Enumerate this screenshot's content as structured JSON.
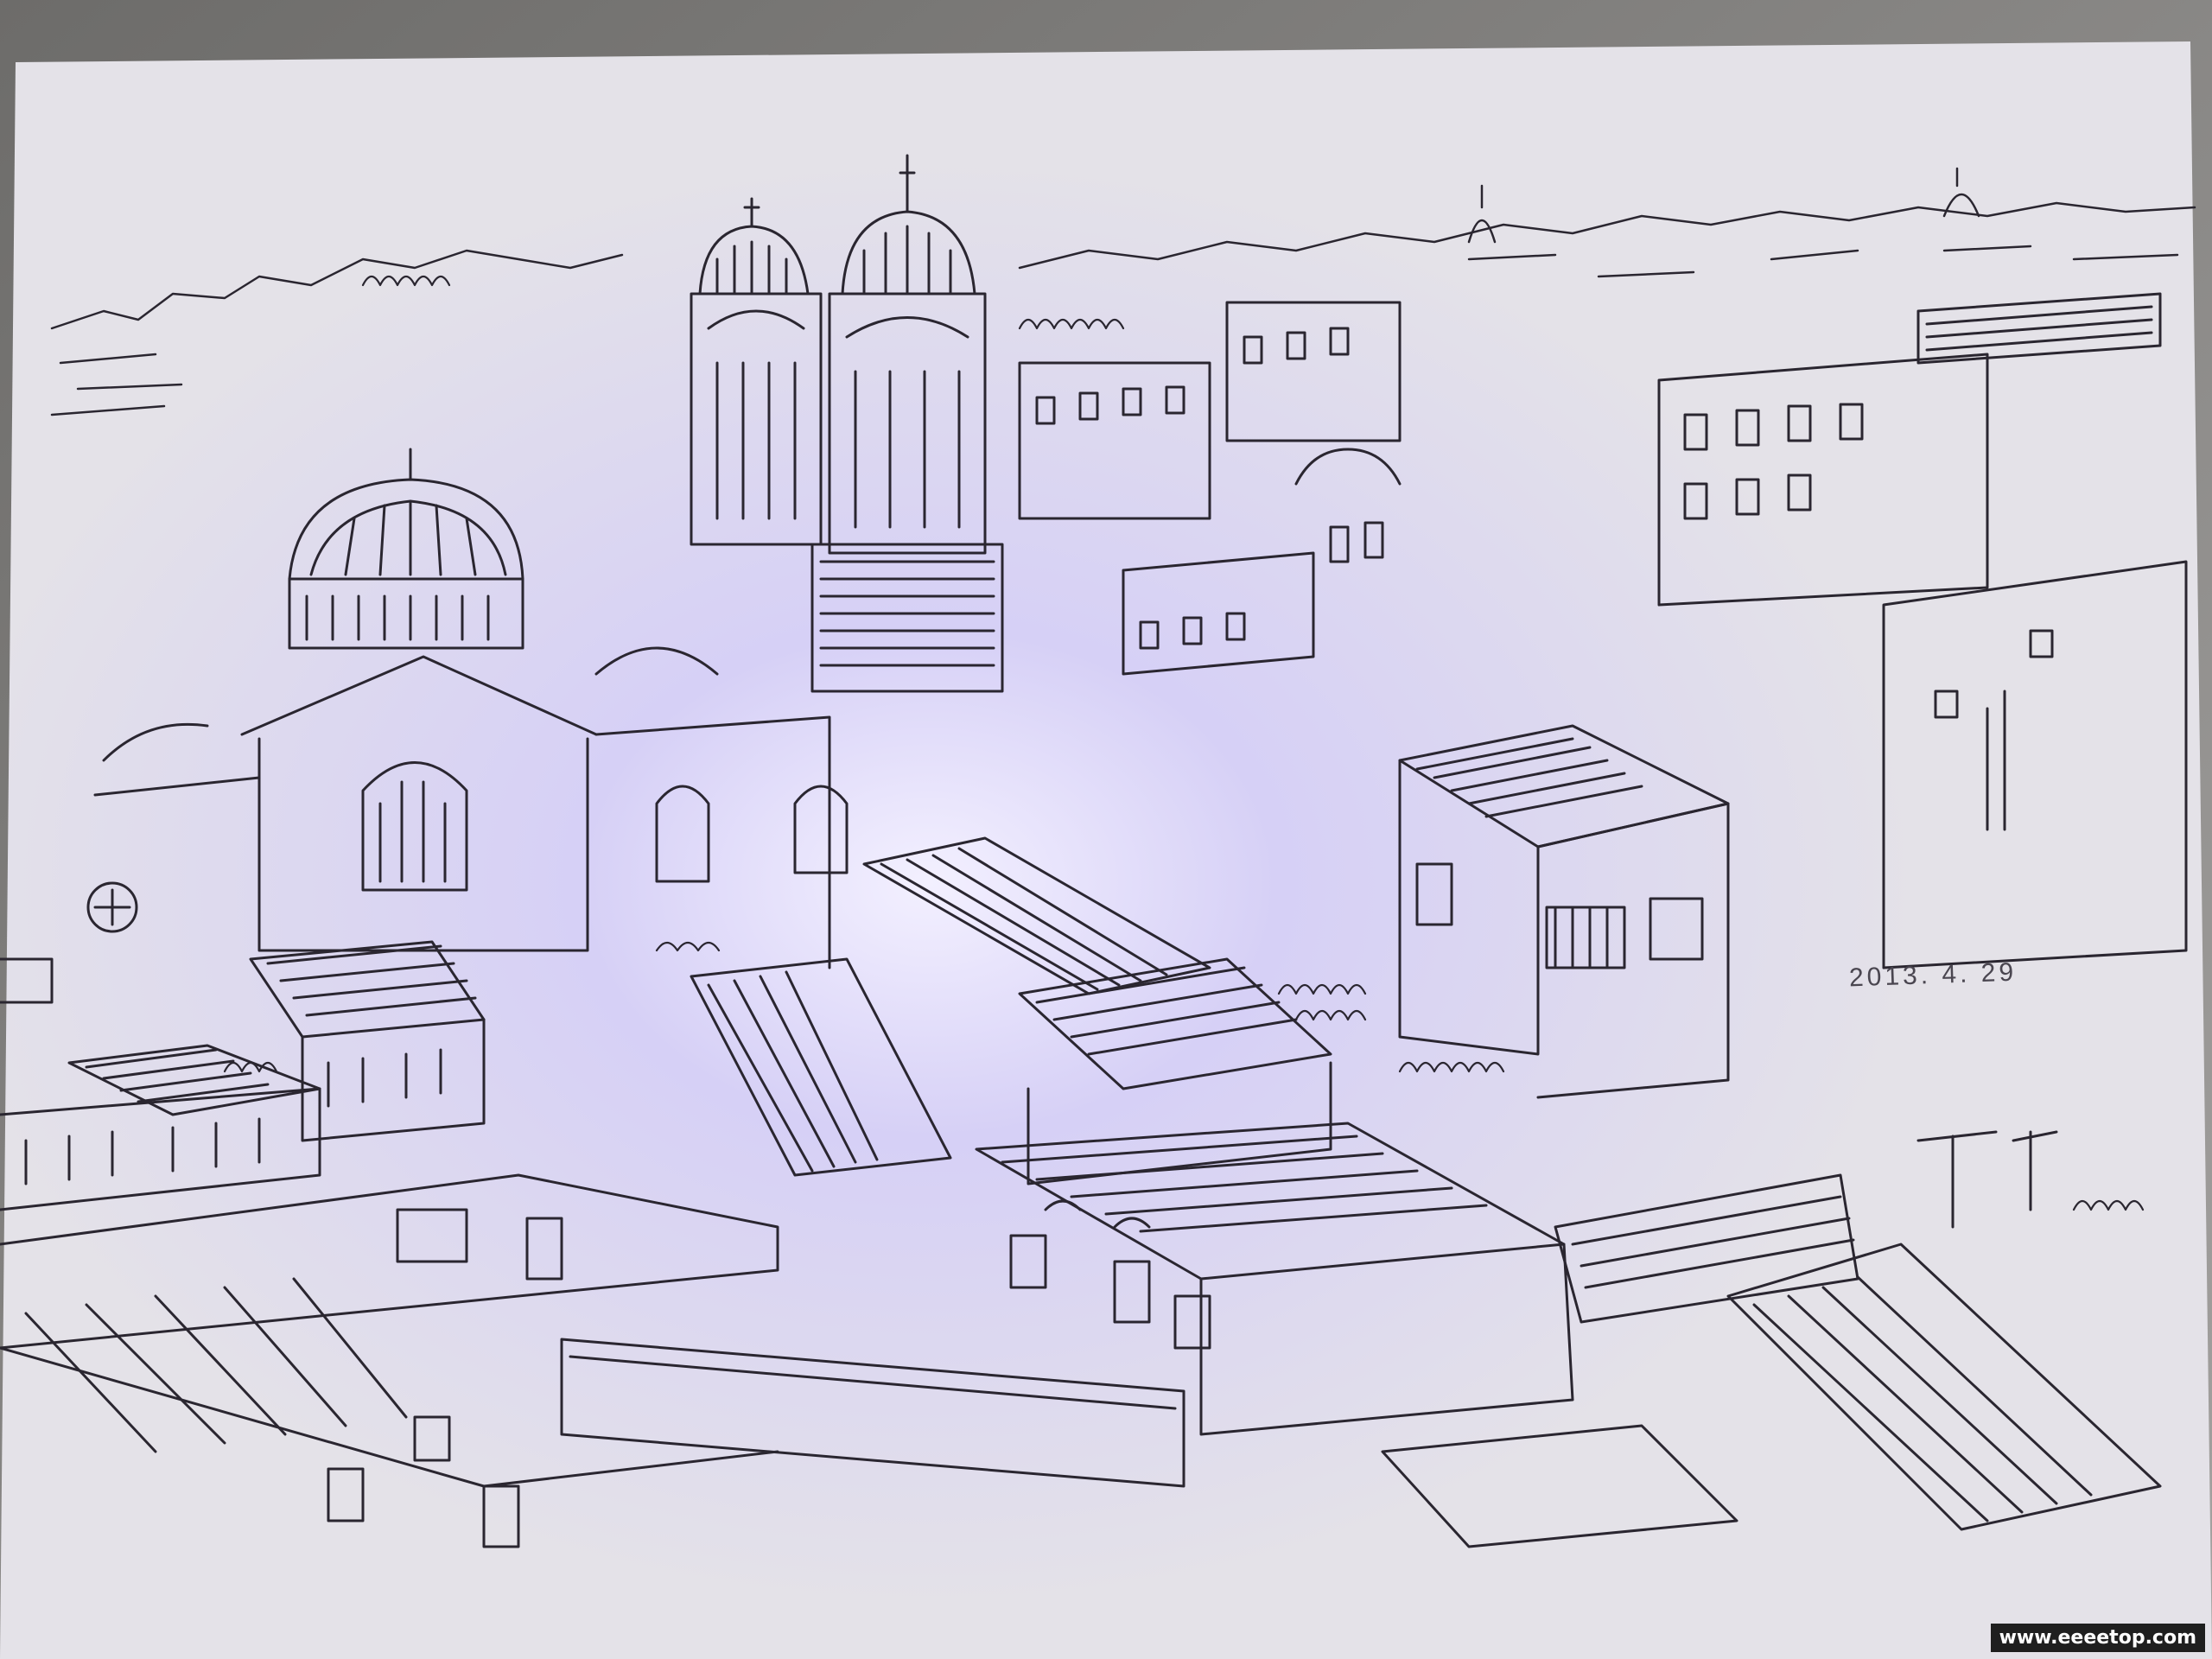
{
  "sketch": {
    "date_text": "2013. 4. 29",
    "ink_color": "#2a2630",
    "paper_color": "#e6e4ea",
    "glow_color": "#c9c2f4"
  },
  "watermark": {
    "text": "www.eeeetop.com"
  }
}
